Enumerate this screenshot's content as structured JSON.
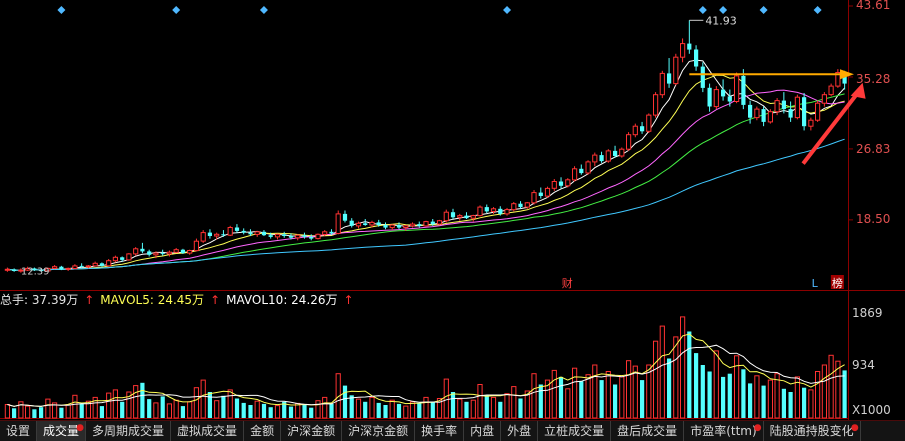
{
  "chart_data": {
    "type": "candlestick",
    "price_axis": {
      "ticks": [
        "43.61",
        "35.28",
        "26.83",
        "18.50"
      ],
      "ylim": [
        10.5,
        43.61
      ]
    },
    "peak_label": "41.93",
    "low_label": "12.39",
    "event_markers": [
      {
        "label": "财",
        "index": 83
      },
      {
        "label": "L",
        "index": 120
      },
      {
        "label": "榜",
        "index": 123
      }
    ],
    "resistance_level": 35.6,
    "candles": [
      [
        12.6,
        12.9,
        12.4,
        12.7
      ],
      [
        12.7,
        12.8,
        12.4,
        12.5
      ],
      [
        12.5,
        12.8,
        12.3,
        12.6
      ],
      [
        12.6,
        13.0,
        12.5,
        12.8
      ],
      [
        12.8,
        12.9,
        12.5,
        12.6
      ],
      [
        12.6,
        12.8,
        12.4,
        12.5
      ],
      [
        12.5,
        12.9,
        12.4,
        12.8
      ],
      [
        12.8,
        13.2,
        12.7,
        13.0
      ],
      [
        13.0,
        13.1,
        12.6,
        12.7
      ],
      [
        12.7,
        12.9,
        12.5,
        12.8
      ],
      [
        12.8,
        13.3,
        12.7,
        13.1
      ],
      [
        13.1,
        13.4,
        12.9,
        13.0
      ],
      [
        13.0,
        13.2,
        12.8,
        13.1
      ],
      [
        13.1,
        13.6,
        13.0,
        13.4
      ],
      [
        13.4,
        13.5,
        13.0,
        13.1
      ],
      [
        13.1,
        13.9,
        13.0,
        13.7
      ],
      [
        13.7,
        14.3,
        13.5,
        14.1
      ],
      [
        14.1,
        14.2,
        13.6,
        13.8
      ],
      [
        13.8,
        14.6,
        13.7,
        14.5
      ],
      [
        14.5,
        15.3,
        14.3,
        15.1
      ],
      [
        15.1,
        15.8,
        14.6,
        14.8
      ],
      [
        14.8,
        15.0,
        14.2,
        14.4
      ],
      [
        14.4,
        14.8,
        14.0,
        14.6
      ],
      [
        14.6,
        15.0,
        14.3,
        14.5
      ],
      [
        14.5,
        14.9,
        14.2,
        14.7
      ],
      [
        14.7,
        15.2,
        14.6,
        15.0
      ],
      [
        15.0,
        15.1,
        14.5,
        14.6
      ],
      [
        14.6,
        15.0,
        14.4,
        14.9
      ],
      [
        14.9,
        16.3,
        14.8,
        16.0
      ],
      [
        16.0,
        17.3,
        15.8,
        17.0
      ],
      [
        17.0,
        17.4,
        16.3,
        16.6
      ],
      [
        16.6,
        17.0,
        16.2,
        16.8
      ],
      [
        16.8,
        17.3,
        16.5,
        16.7
      ],
      [
        16.7,
        17.8,
        16.6,
        17.6
      ],
      [
        17.6,
        18.0,
        17.0,
        17.2
      ],
      [
        17.2,
        17.5,
        16.8,
        17.0
      ],
      [
        17.0,
        17.4,
        16.6,
        16.8
      ],
      [
        16.8,
        17.2,
        16.5,
        17.1
      ],
      [
        17.1,
        17.3,
        16.6,
        16.7
      ],
      [
        16.7,
        17.0,
        16.3,
        16.5
      ],
      [
        16.5,
        16.9,
        16.2,
        16.8
      ],
      [
        16.8,
        17.1,
        16.4,
        16.6
      ],
      [
        16.6,
        16.9,
        16.2,
        16.4
      ],
      [
        16.4,
        16.8,
        16.1,
        16.7
      ],
      [
        16.7,
        17.0,
        16.3,
        16.5
      ],
      [
        16.5,
        16.8,
        16.1,
        16.3
      ],
      [
        16.3,
        16.9,
        16.2,
        16.8
      ],
      [
        16.8,
        17.3,
        16.6,
        17.1
      ],
      [
        17.1,
        17.4,
        16.7,
        16.9
      ],
      [
        16.9,
        19.6,
        16.8,
        19.2
      ],
      [
        19.2,
        19.6,
        18.2,
        18.4
      ],
      [
        18.4,
        18.7,
        17.6,
        17.8
      ],
      [
        17.8,
        18.3,
        17.5,
        18.1
      ],
      [
        18.1,
        18.6,
        17.8,
        17.9
      ],
      [
        17.9,
        18.4,
        17.6,
        18.2
      ],
      [
        18.2,
        18.5,
        17.7,
        17.9
      ],
      [
        17.9,
        18.2,
        17.4,
        17.6
      ],
      [
        17.6,
        18.0,
        17.3,
        17.9
      ],
      [
        17.9,
        18.2,
        17.4,
        17.6
      ],
      [
        17.6,
        17.9,
        17.2,
        17.8
      ],
      [
        17.8,
        18.2,
        17.6,
        18.0
      ],
      [
        18.0,
        18.3,
        17.6,
        17.8
      ],
      [
        17.8,
        18.4,
        17.7,
        18.3
      ],
      [
        18.3,
        18.6,
        17.8,
        18.0
      ],
      [
        18.0,
        18.5,
        17.9,
        18.4
      ],
      [
        18.4,
        19.7,
        18.2,
        19.4
      ],
      [
        19.4,
        19.8,
        18.6,
        18.8
      ],
      [
        18.8,
        19.2,
        18.4,
        19.0
      ],
      [
        19.0,
        19.4,
        18.6,
        18.7
      ],
      [
        18.7,
        19.1,
        18.3,
        19.0
      ],
      [
        19.0,
        20.2,
        18.9,
        20.0
      ],
      [
        20.0,
        20.3,
        19.3,
        19.5
      ],
      [
        19.5,
        20.0,
        19.2,
        19.8
      ],
      [
        19.8,
        20.1,
        19.0,
        19.2
      ],
      [
        19.2,
        19.9,
        19.0,
        19.7
      ],
      [
        19.7,
        20.6,
        19.5,
        20.4
      ],
      [
        20.4,
        20.7,
        19.8,
        20.0
      ],
      [
        20.0,
        20.6,
        19.8,
        20.5
      ],
      [
        20.5,
        22.0,
        20.3,
        21.7
      ],
      [
        21.7,
        22.3,
        21.0,
        21.3
      ],
      [
        21.3,
        22.4,
        21.1,
        22.2
      ],
      [
        22.2,
        23.3,
        21.9,
        23.0
      ],
      [
        23.0,
        23.5,
        22.2,
        22.5
      ],
      [
        22.5,
        23.4,
        22.3,
        23.2
      ],
      [
        23.2,
        24.8,
        23.0,
        24.5
      ],
      [
        24.5,
        25.0,
        23.8,
        24.0
      ],
      [
        24.0,
        25.5,
        23.8,
        25.3
      ],
      [
        25.3,
        26.4,
        24.8,
        26.1
      ],
      [
        26.1,
        26.5,
        25.2,
        25.4
      ],
      [
        25.4,
        26.8,
        25.2,
        26.6
      ],
      [
        26.6,
        27.2,
        25.8,
        26.0
      ],
      [
        26.0,
        27.0,
        25.8,
        26.8
      ],
      [
        26.8,
        28.8,
        26.6,
        28.5
      ],
      [
        28.5,
        29.8,
        28.2,
        29.5
      ],
      [
        29.5,
        30.0,
        28.6,
        28.9
      ],
      [
        28.9,
        31.0,
        28.7,
        30.8
      ],
      [
        30.8,
        33.5,
        30.5,
        33.2
      ],
      [
        33.2,
        36.0,
        32.8,
        35.7
      ],
      [
        35.7,
        37.5,
        34.0,
        34.5
      ],
      [
        34.5,
        38.0,
        34.3,
        37.6
      ],
      [
        37.6,
        39.8,
        37.0,
        39.2
      ],
      [
        39.2,
        41.93,
        38.0,
        38.5
      ],
      [
        38.5,
        39.0,
        36.0,
        36.5
      ],
      [
        36.5,
        37.0,
        33.5,
        34.0
      ],
      [
        34.0,
        34.5,
        31.2,
        31.8
      ],
      [
        31.8,
        34.2,
        31.5,
        33.8
      ],
      [
        33.8,
        35.0,
        32.5,
        33.0
      ],
      [
        33.0,
        33.8,
        31.8,
        32.4
      ],
      [
        32.4,
        35.8,
        32.2,
        35.4
      ],
      [
        35.4,
        36.2,
        31.5,
        32.0
      ],
      [
        32.0,
        32.5,
        29.8,
        30.5
      ],
      [
        30.5,
        31.8,
        30.2,
        31.5
      ],
      [
        31.5,
        31.8,
        29.5,
        30.0
      ],
      [
        30.0,
        31.5,
        29.8,
        31.2
      ],
      [
        31.2,
        32.8,
        30.8,
        32.5
      ],
      [
        32.5,
        33.5,
        31.0,
        31.5
      ],
      [
        31.5,
        32.4,
        30.0,
        30.5
      ],
      [
        30.5,
        33.2,
        30.3,
        32.9
      ],
      [
        32.9,
        33.4,
        29.0,
        29.5
      ],
      [
        29.5,
        30.5,
        29.0,
        30.2
      ],
      [
        30.2,
        32.5,
        30.0,
        32.2
      ],
      [
        32.2,
        33.5,
        31.8,
        33.2
      ],
      [
        33.2,
        34.5,
        33.0,
        34.2
      ],
      [
        34.2,
        36.2,
        34.0,
        35.8
      ],
      [
        35.8,
        36.0,
        33.8,
        34.5
      ]
    ],
    "volume_axis": {
      "ticks": [
        "1869",
        "934"
      ],
      "unit": "X1000",
      "ylim": [
        0,
        1960
      ]
    },
    "volumes": [
      250,
      180,
      300,
      220,
      160,
      200,
      350,
      280,
      190,
      240,
      420,
      260,
      310,
      380,
      220,
      460,
      520,
      300,
      480,
      600,
      650,
      350,
      280,
      400,
      260,
      330,
      220,
      300,
      560,
      700,
      480,
      320,
      410,
      520,
      360,
      280,
      240,
      310,
      260,
      200,
      230,
      300,
      210,
      270,
      240,
      190,
      320,
      380,
      260,
      820,
      600,
      420,
      350,
      300,
      380,
      280,
      240,
      330,
      260,
      220,
      300,
      270,
      380,
      290,
      360,
      720,
      480,
      350,
      300,
      330,
      620,
      420,
      380,
      300,
      450,
      580,
      360,
      500,
      820,
      620,
      700,
      880,
      760,
      540,
      920,
      680,
      800,
      980,
      700,
      860,
      620,
      760,
      1060,
      960,
      700,
      980,
      1420,
      1700,
      1100,
      1500,
      1869,
      1600,
      1200,
      980,
      860,
      1240,
      760,
      820,
      1150,
      900,
      640,
      780,
      600,
      700,
      820,
      540,
      480,
      760,
      560,
      520,
      860,
      980,
      1160,
      1050,
      880
    ],
    "volume_up": [
      1,
      0,
      1,
      1,
      0,
      0,
      1,
      1,
      0,
      1,
      1,
      0,
      1,
      1,
      0,
      1,
      1,
      0,
      1,
      1,
      0,
      0,
      1,
      0,
      1,
      1,
      0,
      1,
      1,
      1,
      0,
      1,
      0,
      1,
      0,
      0,
      0,
      1,
      0,
      0,
      1,
      0,
      0,
      1,
      0,
      0,
      1,
      1,
      0,
      1,
      0,
      0,
      1,
      0,
      1,
      0,
      0,
      1,
      0,
      1,
      1,
      0,
      1,
      0,
      1,
      1,
      0,
      1,
      0,
      1,
      1,
      0,
      1,
      0,
      1,
      1,
      0,
      1,
      1,
      0,
      1,
      1,
      0,
      1,
      1,
      0,
      1,
      1,
      0,
      1,
      0,
      1,
      1,
      1,
      0,
      1,
      1,
      1,
      0,
      1,
      1,
      0,
      0,
      0,
      0,
      1,
      0,
      0,
      1,
      0,
      0,
      1,
      0,
      1,
      1,
      0,
      0,
      1,
      0,
      1,
      1,
      1,
      1,
      1,
      0
    ],
    "volume_legend": {
      "total_label": "总手: 37.39万",
      "mavol5_label": "MAVOL5: 24.45万",
      "mavol10_label": "MAVOL10: 24.26万"
    }
  },
  "colors": {
    "up": "#ff3232",
    "down": "#54ffff",
    "ma5": "#ffffff",
    "ma10": "#ffff55",
    "ma20": "#ff66ff",
    "ma30": "#44ee44",
    "ma60": "#40c8ff",
    "arrow_line": "#ffaa00",
    "annotation_arrow": "#ff3a3a",
    "axis": "#8b0000",
    "marker": "#4fb8ff"
  },
  "tabs": [
    {
      "label": "设置",
      "dot": ""
    },
    {
      "label": "成交量",
      "dot": "●",
      "active": true
    },
    {
      "label": "多周期成交量",
      "dot": ""
    },
    {
      "label": "虚拟成交量",
      "dot": ""
    },
    {
      "label": "金额",
      "dot": ""
    },
    {
      "label": "沪深金额",
      "dot": ""
    },
    {
      "label": "沪深京金额",
      "dot": ""
    },
    {
      "label": "换手率",
      "dot": ""
    },
    {
      "label": "内盘",
      "dot": ""
    },
    {
      "label": "外盘",
      "dot": ""
    },
    {
      "label": "立桩成交量",
      "dot": ""
    },
    {
      "label": "盘后成交量",
      "dot": ""
    },
    {
      "label": "市盈率(ttm)",
      "dot": "●"
    },
    {
      "label": "陆股通持股变化",
      "dot": "●"
    }
  ]
}
